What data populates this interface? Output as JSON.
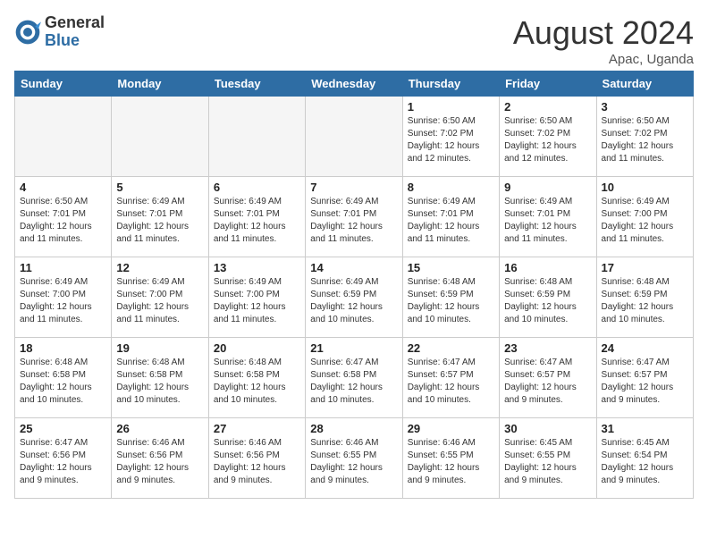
{
  "header": {
    "logo_general": "General",
    "logo_blue": "Blue",
    "month_year": "August 2024",
    "location": "Apac, Uganda"
  },
  "days_of_week": [
    "Sunday",
    "Monday",
    "Tuesday",
    "Wednesday",
    "Thursday",
    "Friday",
    "Saturday"
  ],
  "weeks": [
    [
      {
        "day": "",
        "empty": true
      },
      {
        "day": "",
        "empty": true
      },
      {
        "day": "",
        "empty": true
      },
      {
        "day": "",
        "empty": true
      },
      {
        "day": "1",
        "sunrise": "6:50 AM",
        "sunset": "7:02 PM",
        "daylight": "12 hours and 12 minutes."
      },
      {
        "day": "2",
        "sunrise": "6:50 AM",
        "sunset": "7:02 PM",
        "daylight": "12 hours and 12 minutes."
      },
      {
        "day": "3",
        "sunrise": "6:50 AM",
        "sunset": "7:02 PM",
        "daylight": "12 hours and 11 minutes."
      }
    ],
    [
      {
        "day": "4",
        "sunrise": "6:50 AM",
        "sunset": "7:01 PM",
        "daylight": "12 hours and 11 minutes."
      },
      {
        "day": "5",
        "sunrise": "6:49 AM",
        "sunset": "7:01 PM",
        "daylight": "12 hours and 11 minutes."
      },
      {
        "day": "6",
        "sunrise": "6:49 AM",
        "sunset": "7:01 PM",
        "daylight": "12 hours and 11 minutes."
      },
      {
        "day": "7",
        "sunrise": "6:49 AM",
        "sunset": "7:01 PM",
        "daylight": "12 hours and 11 minutes."
      },
      {
        "day": "8",
        "sunrise": "6:49 AM",
        "sunset": "7:01 PM",
        "daylight": "12 hours and 11 minutes."
      },
      {
        "day": "9",
        "sunrise": "6:49 AM",
        "sunset": "7:01 PM",
        "daylight": "12 hours and 11 minutes."
      },
      {
        "day": "10",
        "sunrise": "6:49 AM",
        "sunset": "7:00 PM",
        "daylight": "12 hours and 11 minutes."
      }
    ],
    [
      {
        "day": "11",
        "sunrise": "6:49 AM",
        "sunset": "7:00 PM",
        "daylight": "12 hours and 11 minutes."
      },
      {
        "day": "12",
        "sunrise": "6:49 AM",
        "sunset": "7:00 PM",
        "daylight": "12 hours and 11 minutes."
      },
      {
        "day": "13",
        "sunrise": "6:49 AM",
        "sunset": "7:00 PM",
        "daylight": "12 hours and 11 minutes."
      },
      {
        "day": "14",
        "sunrise": "6:49 AM",
        "sunset": "6:59 PM",
        "daylight": "12 hours and 10 minutes."
      },
      {
        "day": "15",
        "sunrise": "6:48 AM",
        "sunset": "6:59 PM",
        "daylight": "12 hours and 10 minutes."
      },
      {
        "day": "16",
        "sunrise": "6:48 AM",
        "sunset": "6:59 PM",
        "daylight": "12 hours and 10 minutes."
      },
      {
        "day": "17",
        "sunrise": "6:48 AM",
        "sunset": "6:59 PM",
        "daylight": "12 hours and 10 minutes."
      }
    ],
    [
      {
        "day": "18",
        "sunrise": "6:48 AM",
        "sunset": "6:58 PM",
        "daylight": "12 hours and 10 minutes."
      },
      {
        "day": "19",
        "sunrise": "6:48 AM",
        "sunset": "6:58 PM",
        "daylight": "12 hours and 10 minutes."
      },
      {
        "day": "20",
        "sunrise": "6:48 AM",
        "sunset": "6:58 PM",
        "daylight": "12 hours and 10 minutes."
      },
      {
        "day": "21",
        "sunrise": "6:47 AM",
        "sunset": "6:58 PM",
        "daylight": "12 hours and 10 minutes."
      },
      {
        "day": "22",
        "sunrise": "6:47 AM",
        "sunset": "6:57 PM",
        "daylight": "12 hours and 10 minutes."
      },
      {
        "day": "23",
        "sunrise": "6:47 AM",
        "sunset": "6:57 PM",
        "daylight": "12 hours and 9 minutes."
      },
      {
        "day": "24",
        "sunrise": "6:47 AM",
        "sunset": "6:57 PM",
        "daylight": "12 hours and 9 minutes."
      }
    ],
    [
      {
        "day": "25",
        "sunrise": "6:47 AM",
        "sunset": "6:56 PM",
        "daylight": "12 hours and 9 minutes."
      },
      {
        "day": "26",
        "sunrise": "6:46 AM",
        "sunset": "6:56 PM",
        "daylight": "12 hours and 9 minutes."
      },
      {
        "day": "27",
        "sunrise": "6:46 AM",
        "sunset": "6:56 PM",
        "daylight": "12 hours and 9 minutes."
      },
      {
        "day": "28",
        "sunrise": "6:46 AM",
        "sunset": "6:55 PM",
        "daylight": "12 hours and 9 minutes."
      },
      {
        "day": "29",
        "sunrise": "6:46 AM",
        "sunset": "6:55 PM",
        "daylight": "12 hours and 9 minutes."
      },
      {
        "day": "30",
        "sunrise": "6:45 AM",
        "sunset": "6:55 PM",
        "daylight": "12 hours and 9 minutes."
      },
      {
        "day": "31",
        "sunrise": "6:45 AM",
        "sunset": "6:54 PM",
        "daylight": "12 hours and 9 minutes."
      }
    ]
  ],
  "labels": {
    "sunrise": "Sunrise:",
    "sunset": "Sunset:",
    "daylight": "Daylight:"
  }
}
